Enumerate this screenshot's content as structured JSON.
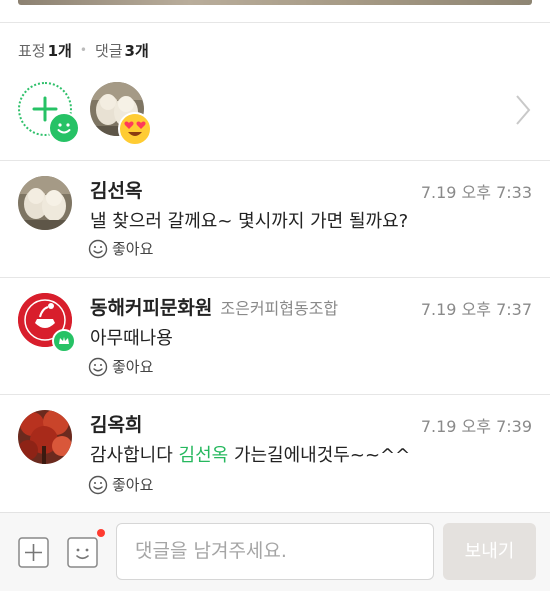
{
  "summary": {
    "reactions_label": "표정",
    "reactions_count": "1개",
    "comments_label": "댓글",
    "comments_count": "3개"
  },
  "reactions": {
    "add_icon": "add-reaction-icon",
    "badge_icon": "smile-icon",
    "reactor_emoji": "heart-eyes-icon"
  },
  "comments": [
    {
      "author": "김선옥",
      "org": "",
      "time": "7.19 오후 7:33",
      "text": "낼 찾으러 갈께요~ 몇시까지 가면 될까요?",
      "like_label": "좋아요"
    },
    {
      "author": "동해커피문화원",
      "org": "조은커피협동조합",
      "time": "7.19 오후 7:37",
      "text": "아무때나용",
      "like_label": "좋아요"
    },
    {
      "author": "김옥희",
      "org": "",
      "time": "7.19 오후 7:39",
      "text_before": "감사합니다 ",
      "mention": "김선옥",
      "text_after": " 가는길에내것두~~^^",
      "like_label": "좋아요"
    }
  ],
  "composer": {
    "placeholder": "댓글을 남겨주세요.",
    "send_label": "보내기"
  },
  "colors": {
    "accent_green": "#26c265",
    "mention_green": "#26b85e",
    "notification_red": "#ff3b30"
  }
}
